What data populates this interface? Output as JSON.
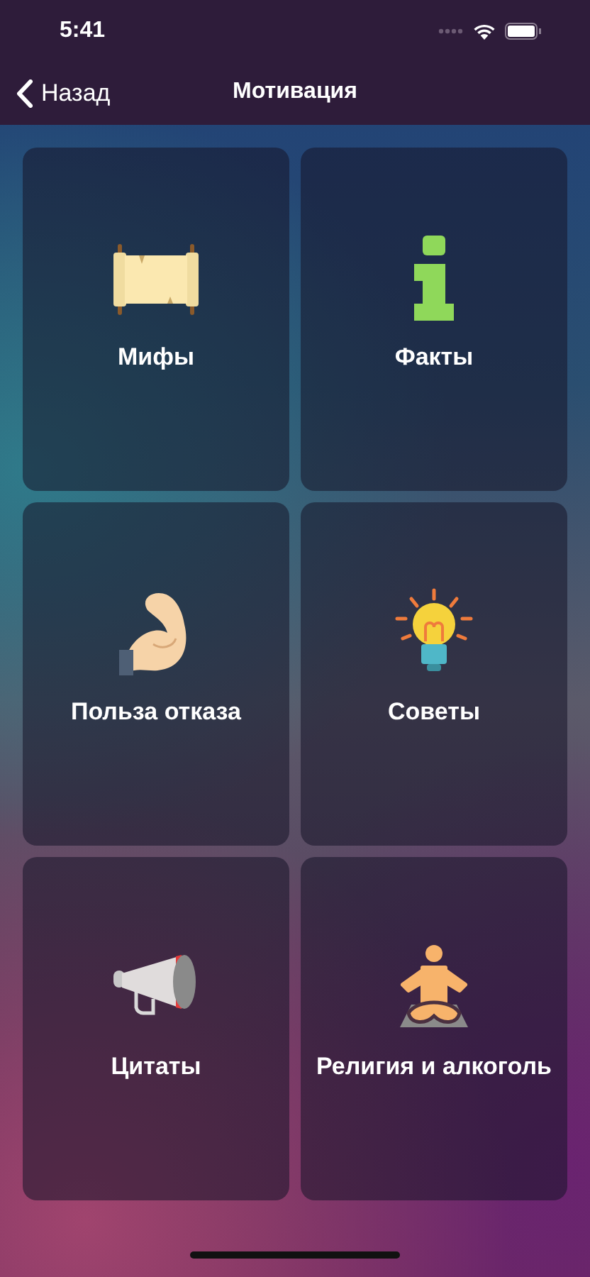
{
  "status_bar": {
    "time": "5:41"
  },
  "nav_bar": {
    "back": "Назад",
    "title": "Мотивация"
  },
  "tiles": [
    {
      "label": "Мифы",
      "kind": "scroll"
    },
    {
      "label": "Факты",
      "kind": "info"
    },
    {
      "label": "Польза отказа",
      "kind": "muscle"
    },
    {
      "label": "Советы",
      "kind": "bulb"
    },
    {
      "label": "Цитаты",
      "kind": "megaphone"
    },
    {
      "label": "Религия и алкоголь",
      "kind": "meditation"
    }
  ]
}
